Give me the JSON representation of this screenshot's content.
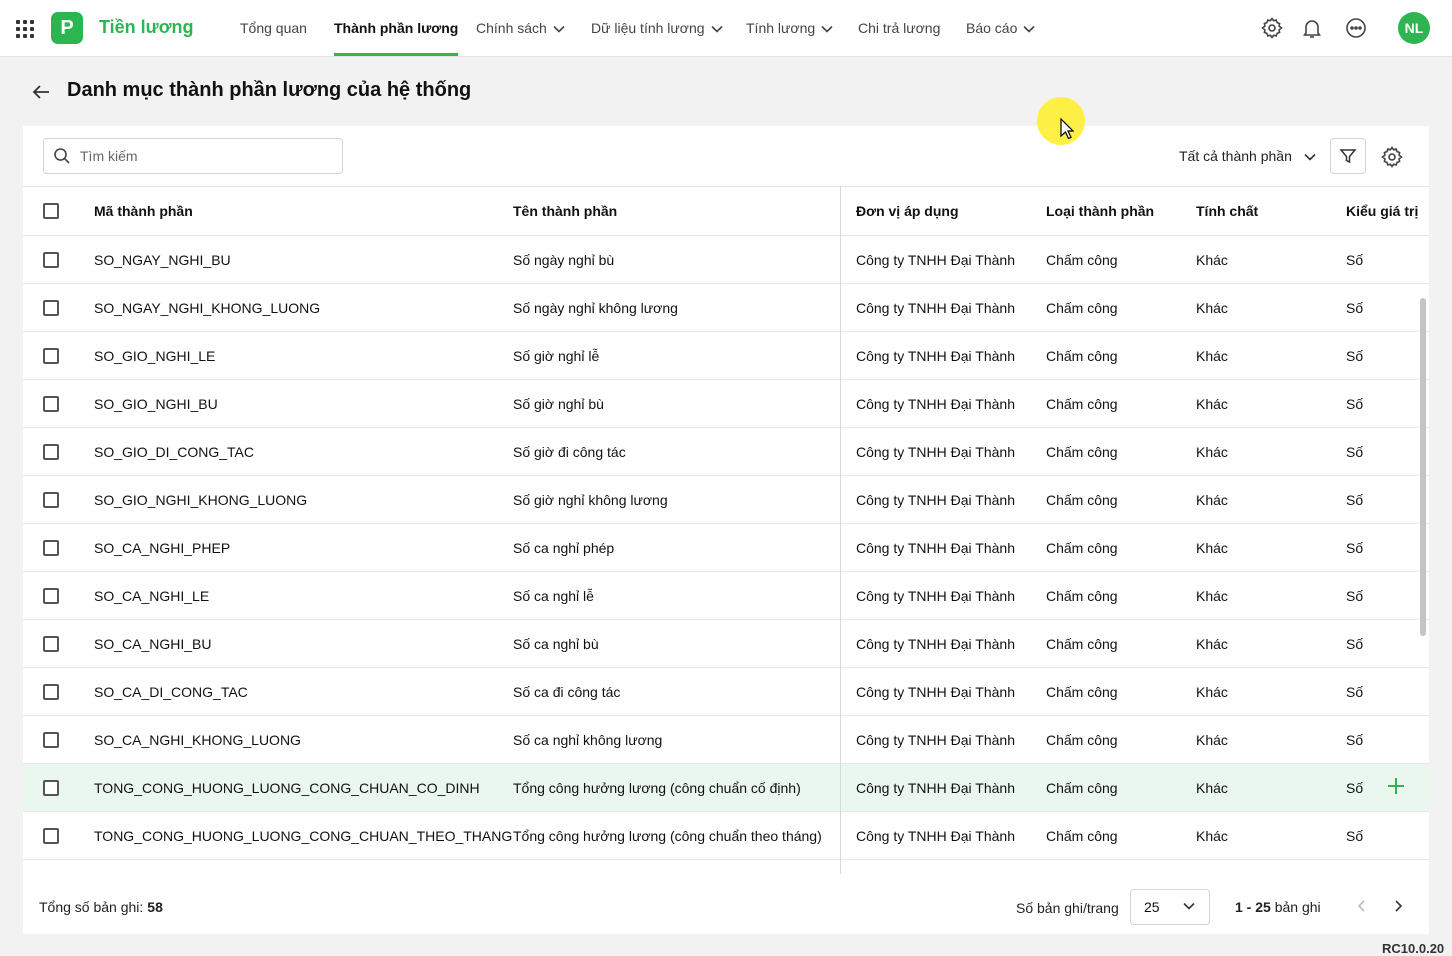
{
  "app": {
    "name": "Tiền lương",
    "logo_letter": "P",
    "brand_color": "#2db552"
  },
  "nav": [
    {
      "label": "Tổng quan",
      "active": false,
      "dropdown": false
    },
    {
      "label": "Thành phần lương",
      "active": true,
      "dropdown": false
    },
    {
      "label": "Chính sách",
      "active": false,
      "dropdown": true
    },
    {
      "label": "Dữ liệu tính lương",
      "active": false,
      "dropdown": true
    },
    {
      "label": "Tính lương",
      "active": false,
      "dropdown": true
    },
    {
      "label": "Chi trả lương",
      "active": false,
      "dropdown": false
    },
    {
      "label": "Báo cáo",
      "active": false,
      "dropdown": true
    }
  ],
  "user": {
    "initials": "NL"
  },
  "page": {
    "title": "Danh mục thành phần lương của hệ thống"
  },
  "search": {
    "placeholder": "Tìm kiếm",
    "value": ""
  },
  "filter": {
    "selected": "Tất cả thành phần"
  },
  "table": {
    "columns": [
      "Mã thành phần",
      "Tên thành phần",
      "Đơn vị áp dụng",
      "Loại thành phần",
      "Tính chất",
      "Kiểu giá trị"
    ],
    "rows": [
      [
        "SO_NGAY_NGHI_BU",
        "Số ngày nghỉ bù",
        "Công ty TNHH Đại Thành",
        "Chấm công",
        "Khác",
        "Số"
      ],
      [
        "SO_NGAY_NGHI_KHONG_LUONG",
        "Số ngày nghỉ không lương",
        "Công ty TNHH Đại Thành",
        "Chấm công",
        "Khác",
        "Số"
      ],
      [
        "SO_GIO_NGHI_LE",
        "Số giờ nghỉ lễ",
        "Công ty TNHH Đại Thành",
        "Chấm công",
        "Khác",
        "Số"
      ],
      [
        "SO_GIO_NGHI_BU",
        "Số giờ nghỉ bù",
        "Công ty TNHH Đại Thành",
        "Chấm công",
        "Khác",
        "Số"
      ],
      [
        "SO_GIO_DI_CONG_TAC",
        "Số giờ đi công tác",
        "Công ty TNHH Đại Thành",
        "Chấm công",
        "Khác",
        "Số"
      ],
      [
        "SO_GIO_NGHI_KHONG_LUONG",
        "Số giờ nghỉ không lương",
        "Công ty TNHH Đại Thành",
        "Chấm công",
        "Khác",
        "Số"
      ],
      [
        "SO_CA_NGHI_PHEP",
        "Số ca nghỉ phép",
        "Công ty TNHH Đại Thành",
        "Chấm công",
        "Khác",
        "Số"
      ],
      [
        "SO_CA_NGHI_LE",
        "Số ca nghỉ lễ",
        "Công ty TNHH Đại Thành",
        "Chấm công",
        "Khác",
        "Số"
      ],
      [
        "SO_CA_NGHI_BU",
        "Số ca nghỉ bù",
        "Công ty TNHH Đại Thành",
        "Chấm công",
        "Khác",
        "Số"
      ],
      [
        "SO_CA_DI_CONG_TAC",
        "Số ca đi công tác",
        "Công ty TNHH Đại Thành",
        "Chấm công",
        "Khác",
        "Số"
      ],
      [
        "SO_CA_NGHI_KHONG_LUONG",
        "Số ca nghỉ không lương",
        "Công ty TNHH Đại Thành",
        "Chấm công",
        "Khác",
        "Số"
      ],
      [
        "TONG_CONG_HUONG_LUONG_CONG_CHUAN_CO_DINH",
        "Tổng công hưởng lương (công chuẩn cố định)",
        "Công ty TNHH Đại Thành",
        "Chấm công",
        "Khác",
        "Số"
      ],
      [
        "TONG_CONG_HUONG_LUONG_CONG_CHUAN_THEO_THANG",
        "Tổng công hưởng lương (công chuẩn theo tháng)",
        "Công ty TNHH Đại Thành",
        "Chấm công",
        "Khác",
        "Số"
      ]
    ],
    "highlighted_row": 11
  },
  "footer": {
    "total_label": "Tổng số bản ghi:",
    "total": "58",
    "per_page_label": "Số bản ghi/trang",
    "per_page": "25",
    "range": "1 - 25",
    "range_suffix": "bản ghi"
  },
  "version": "RC10.0.20"
}
